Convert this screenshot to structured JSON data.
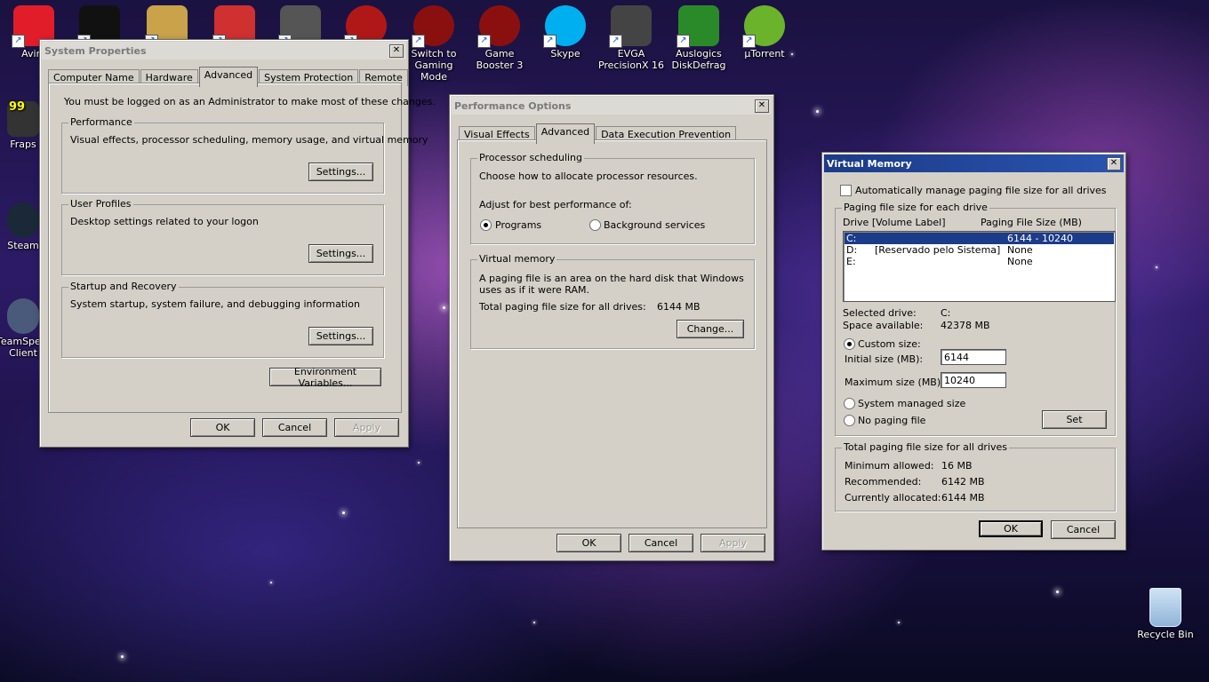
{
  "desktop": {
    "icons": [
      {
        "label": "Avira",
        "color": "#e11d2a"
      },
      {
        "label": "",
        "color": "#111111"
      },
      {
        "label": "",
        "color": "#c9a24a"
      },
      {
        "label": "",
        "color": "#cf3030"
      },
      {
        "label": "",
        "color": "#555555"
      },
      {
        "label": "",
        "color": "#b01818"
      },
      {
        "label": "Switch to Gaming Mode",
        "color": "#8a1010"
      },
      {
        "label": "Game Booster 3",
        "color": "#8a1010"
      },
      {
        "label": "Skype",
        "color": "#00aff0"
      },
      {
        "label": "EVGA PrecisionX 16",
        "color": "#444444"
      },
      {
        "label": "Auslogics DiskDefrag",
        "color": "#2a8a2a"
      },
      {
        "label": "µTorrent",
        "color": "#6bb32a"
      }
    ],
    "left_icons": [
      {
        "label": "Fraps",
        "badge": "99"
      },
      {
        "label": "Steam"
      },
      {
        "label": "TeamSpeak Client"
      }
    ],
    "recycle_bin": "Recycle Bin"
  },
  "system_properties": {
    "title": "System Properties",
    "tabs": [
      "Computer Name",
      "Hardware",
      "Advanced",
      "System Protection",
      "Remote"
    ],
    "selected_tab": "Advanced",
    "admin_note": "You must be logged on as an Administrator to make most of these changes.",
    "performance": {
      "legend": "Performance",
      "text": "Visual effects, processor scheduling, memory usage, and virtual memory",
      "button": "Settings..."
    },
    "user_profiles": {
      "legend": "User Profiles",
      "text": "Desktop settings related to your logon",
      "button": "Settings..."
    },
    "startup": {
      "legend": "Startup and Recovery",
      "text": "System startup, system failure, and debugging information",
      "button": "Settings..."
    },
    "env_button": "Environment Variables...",
    "ok": "OK",
    "cancel": "Cancel",
    "apply": "Apply"
  },
  "performance_options": {
    "title": "Performance Options",
    "tabs": [
      "Visual Effects",
      "Advanced",
      "Data Execution Prevention"
    ],
    "selected_tab": "Advanced",
    "processor": {
      "legend": "Processor scheduling",
      "text": "Choose how to allocate processor resources.",
      "adjust": "Adjust for best performance of:",
      "opt_programs": "Programs",
      "opt_background": "Background services"
    },
    "vm": {
      "legend": "Virtual memory",
      "text": "A paging file is an area on the hard disk that Windows uses as if it were RAM.",
      "total_label": "Total paging file size for all drives:",
      "total_value": "6144 MB",
      "change": "Change..."
    },
    "ok": "OK",
    "cancel": "Cancel",
    "apply": "Apply"
  },
  "virtual_memory": {
    "title": "Virtual Memory",
    "auto_manage": "Automatically manage paging file size for all drives",
    "paging_legend": "Paging file size for each drive",
    "col_drive": "Drive  [Volume Label]",
    "col_size": "Paging File Size (MB)",
    "drives": [
      {
        "drive": "C:",
        "label": "",
        "size": "6144 - 10240"
      },
      {
        "drive": "D:",
        "label": "[Reservado pelo Sistema]",
        "size": "None"
      },
      {
        "drive": "E:",
        "label": "",
        "size": "None"
      }
    ],
    "selected_drive_label": "Selected drive:",
    "selected_drive_value": "C:",
    "space_label": "Space available:",
    "space_value": "42378 MB",
    "custom_size": "Custom size:",
    "initial_label": "Initial size (MB):",
    "initial_value": "6144",
    "max_label": "Maximum size (MB):",
    "max_value": "10240",
    "system_managed": "System managed size",
    "no_paging": "No paging file",
    "set": "Set",
    "total_legend": "Total paging file size for all drives",
    "min_label": "Minimum allowed:",
    "min_value": "16 MB",
    "rec_label": "Recommended:",
    "rec_value": "6142 MB",
    "cur_label": "Currently allocated:",
    "cur_value": "6144 MB",
    "ok": "OK",
    "cancel": "Cancel"
  }
}
